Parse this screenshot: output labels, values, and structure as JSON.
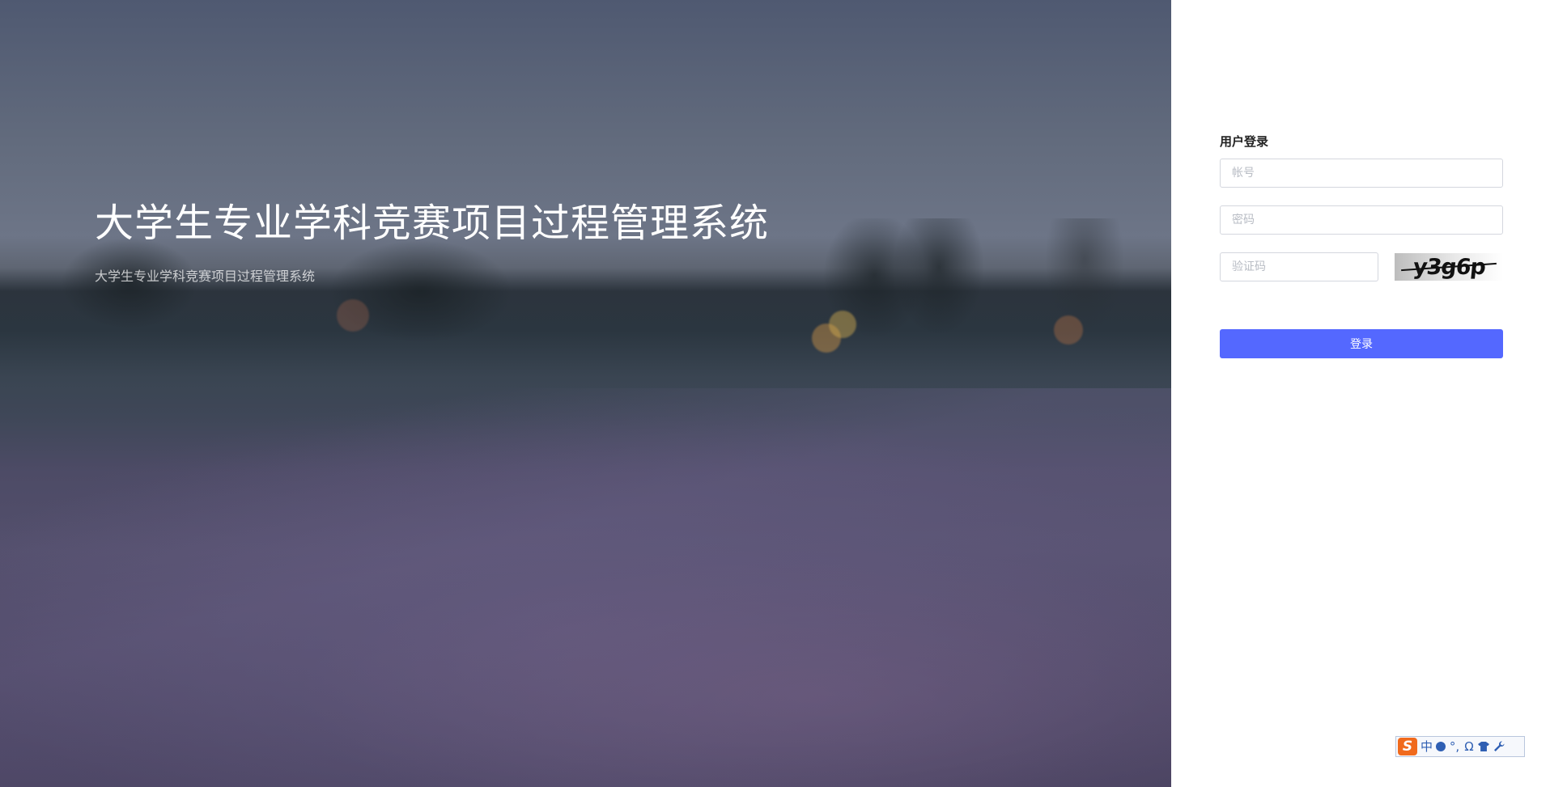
{
  "hero": {
    "title": "大学生专业学科竞赛项目过程管理系统",
    "subtitle": "大学生专业学科竞赛项目过程管理系统"
  },
  "login": {
    "title": "用户登录",
    "account_placeholder": "帐号",
    "password_placeholder": "密码",
    "captcha_placeholder": "验证码",
    "captcha_text": "y3g6p",
    "submit_label": "登录"
  },
  "ime_toolbar": {
    "logo": "S",
    "mode": "中",
    "punct": "°,",
    "symbol": "Ω",
    "icons": [
      "sogou-logo-icon",
      "language-mode-icon",
      "moon-dot-icon",
      "punctuation-icon",
      "symbol-omega-icon",
      "skin-shirt-icon",
      "wrench-icon"
    ]
  },
  "colors": {
    "primary_button": "#5468ff",
    "ime_logo": "#f06a1d",
    "ime_icon": "#2f5fb3"
  }
}
